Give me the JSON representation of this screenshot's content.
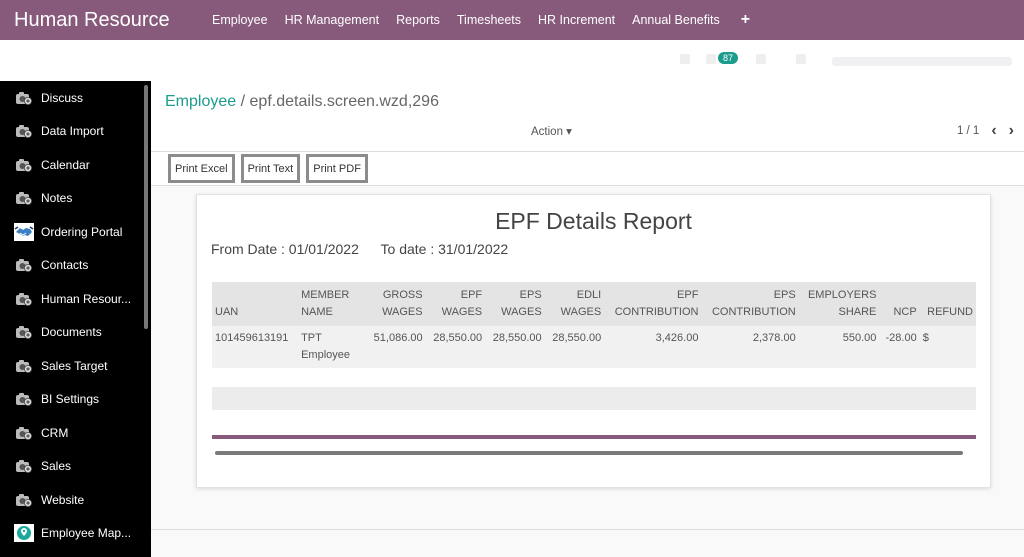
{
  "topbar": {
    "app_title": "Human Resource",
    "menu": [
      "Employee",
      "HR Management",
      "Reports",
      "Timesheets",
      "HR Increment",
      "Annual Benefits"
    ],
    "add_icon": "plus-icon",
    "color": "#875a7b"
  },
  "systray": {
    "badge_count": "87",
    "badge_color": "#1c9c8c"
  },
  "sidebar": {
    "items": [
      {
        "label": "Discuss",
        "icon": "camera-plus-icon"
      },
      {
        "label": "Data Import",
        "icon": "camera-plus-icon"
      },
      {
        "label": "Calendar",
        "icon": "camera-plus-icon"
      },
      {
        "label": "Notes",
        "icon": "camera-plus-icon"
      },
      {
        "label": "Ordering Portal",
        "icon": "handshake-icon"
      },
      {
        "label": "Contacts",
        "icon": "camera-plus-icon"
      },
      {
        "label": "Human Resour...",
        "icon": "camera-plus-icon"
      },
      {
        "label": "Documents",
        "icon": "camera-plus-icon"
      },
      {
        "label": "Sales Target",
        "icon": "camera-plus-icon"
      },
      {
        "label": "BI Settings",
        "icon": "camera-plus-icon"
      },
      {
        "label": "CRM",
        "icon": "camera-plus-icon"
      },
      {
        "label": "Sales",
        "icon": "camera-plus-icon"
      },
      {
        "label": "Website",
        "icon": "camera-plus-icon"
      },
      {
        "label": "Employee Map...",
        "icon": "map-pin-icon"
      }
    ]
  },
  "control_panel": {
    "breadcrumb_parent": "Employee",
    "breadcrumb_separator": "/",
    "breadcrumb_current": "epf.details.screen.wzd,296",
    "action_label": "Action ▾",
    "pager": "1 / 1",
    "prev_icon": "‹",
    "next_icon": "›",
    "accent": "#1c9c8c"
  },
  "buttons": {
    "print_excel": "Print Excel",
    "print_text": "Print Text",
    "print_pdf": "Print PDF"
  },
  "report": {
    "title": "EPF Details Report",
    "from_date": "From Date : 01/01/2022",
    "to_date": "To date : 31/01/2022",
    "columns": [
      "UAN",
      "MEMBER\nNAME",
      "GROSS\nWAGES",
      "EPF\nWAGES",
      "EPS\nWAGES",
      "EDLI\nWAGES",
      "EPF\nCONTRIBUTION",
      "EPS\nCONTRIBUTION",
      "EMPLOYERS\nSHARE",
      "NCP",
      "REFUND"
    ],
    "rows": [
      [
        "101459613191",
        "TPT Employee",
        "51,086.00",
        "28,550.00",
        "28,550.00",
        "28,550.00",
        "3,426.00",
        "2,378.00",
        "550.00",
        "-28.00",
        "$"
      ]
    ]
  }
}
